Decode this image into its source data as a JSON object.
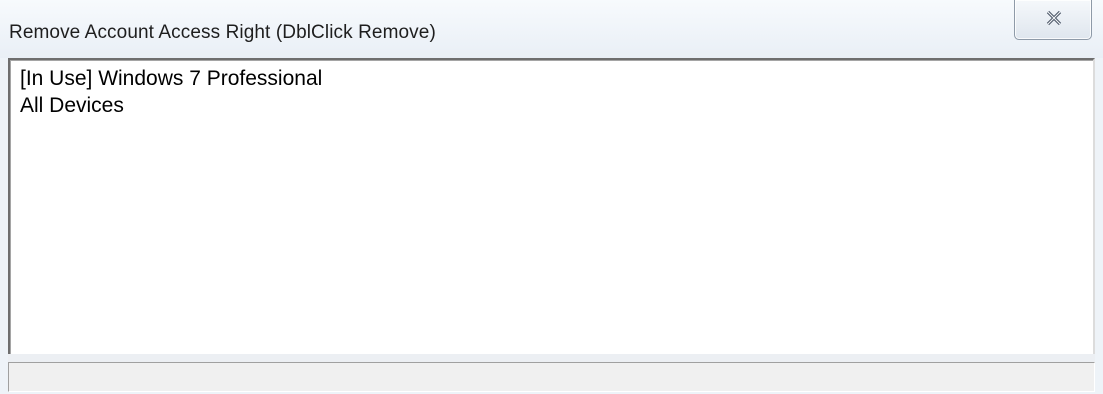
{
  "window": {
    "title": "Remove Account Access Right (DblClick Remove)",
    "close_icon": "close-x-icon"
  },
  "list": {
    "items": [
      {
        "label": "[In Use] Windows 7 Professional"
      },
      {
        "label": "All Devices"
      }
    ]
  },
  "statusbar": {
    "text": ""
  }
}
